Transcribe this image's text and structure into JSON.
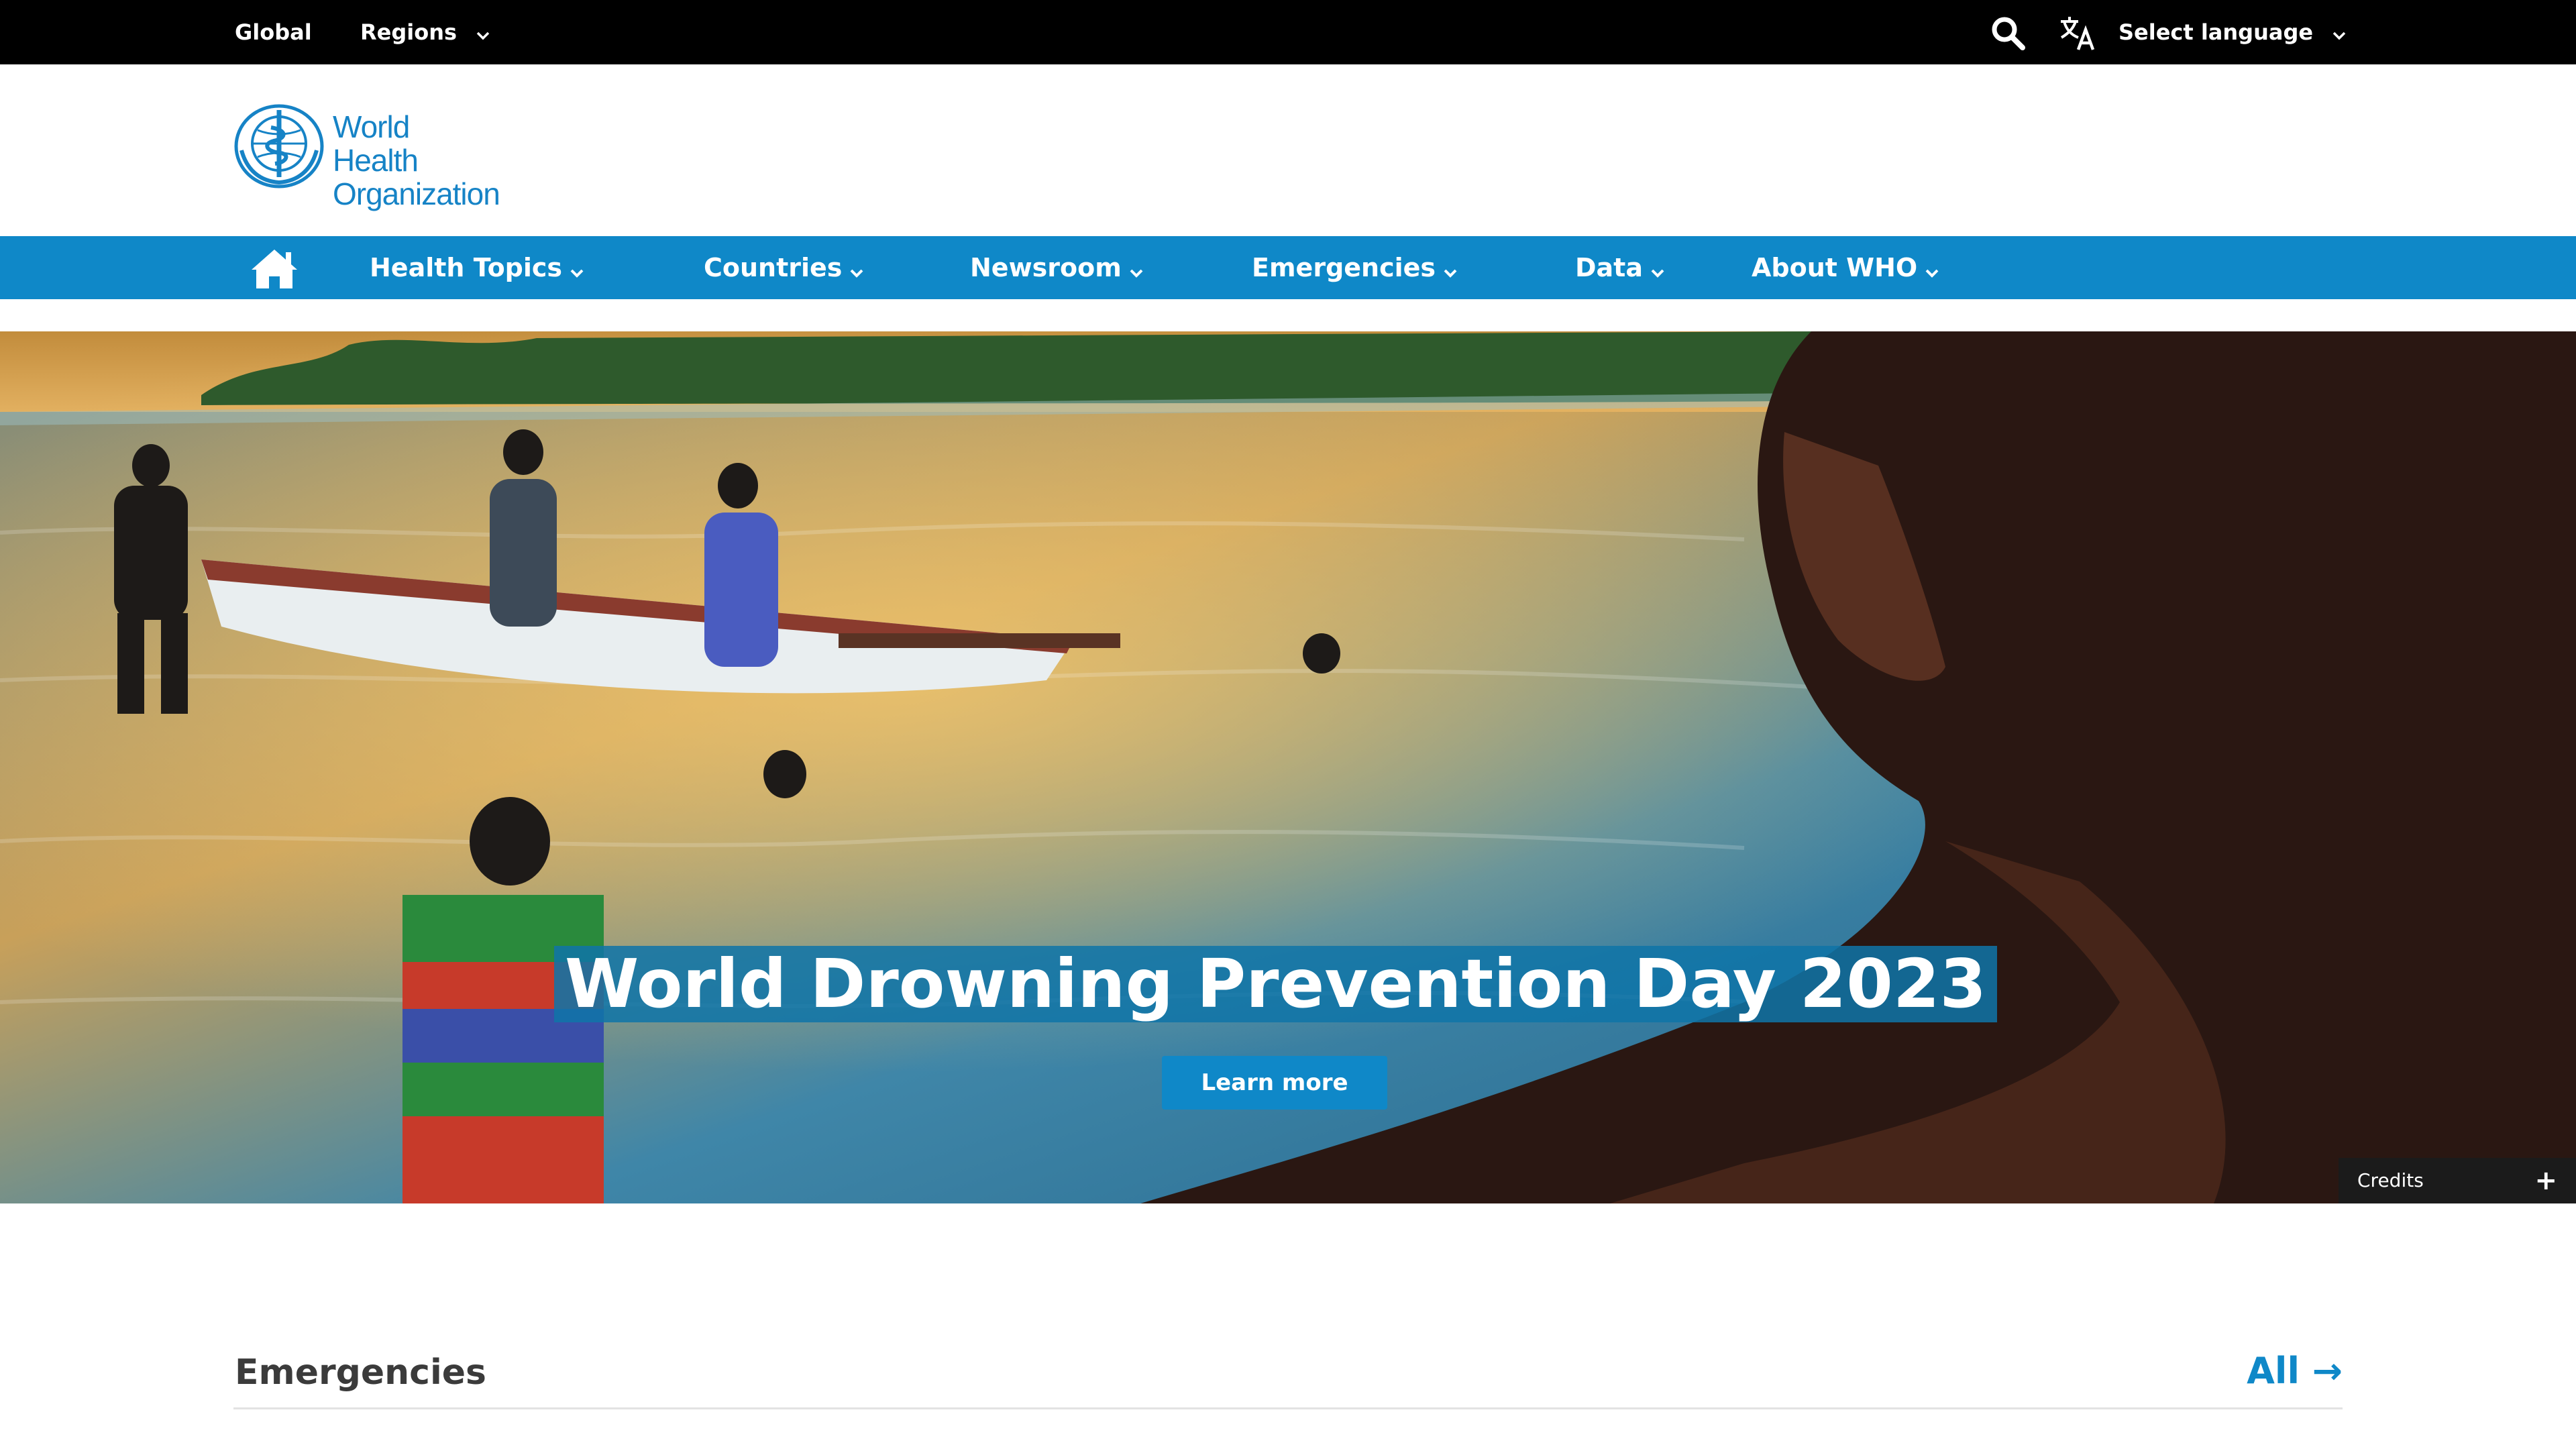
{
  "topbar": {
    "global_label": "Global",
    "regions_label": "Regions",
    "language_label": "Select language",
    "icons": [
      "search-icon",
      "translate-icon",
      "chevron-down-icon"
    ]
  },
  "header": {
    "logo_line1": "World Health",
    "logo_line2": "Organization"
  },
  "nav": {
    "items": [
      {
        "label": "Health Topics"
      },
      {
        "label": "Countries"
      },
      {
        "label": "Newsroom"
      },
      {
        "label": "Emergencies"
      },
      {
        "label": "Data"
      },
      {
        "label": "About WHO"
      }
    ],
    "icons": [
      "home-icon",
      "chevron-down-icon"
    ]
  },
  "hero": {
    "title": "World Drowning Prevention Day 2023",
    "button_label": "Learn more",
    "credits_label": "Credits",
    "credits_toggle": "+"
  },
  "section": {
    "title": "Emergencies",
    "all_label": "All →"
  },
  "colors": {
    "brand_blue": "#0f88c8",
    "logo_blue": "#1683c6",
    "topbar_bg": "#000000",
    "title_bg": "#0f74a8",
    "text_dark": "#3b3b3b"
  }
}
